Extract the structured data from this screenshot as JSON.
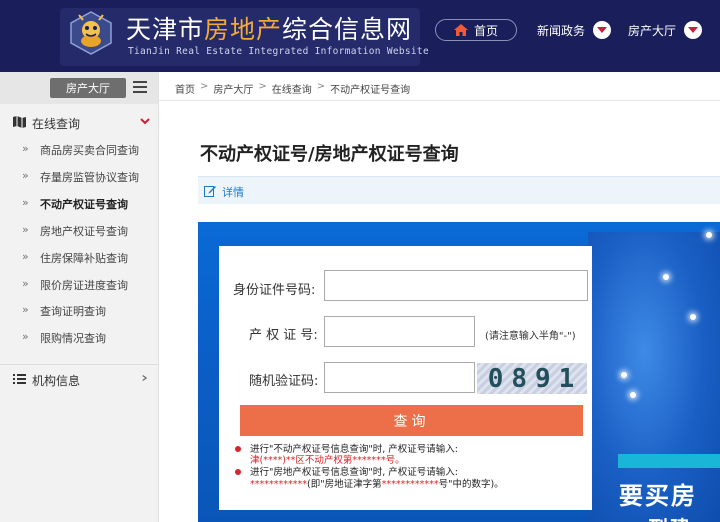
{
  "header": {
    "title_part1": "天津市",
    "title_accent": "房地产",
    "title_part2": "综合信息网",
    "subtitle": "TianJin Real Estate Integrated Information Website",
    "home_label": "首页",
    "nav": [
      {
        "label": "新闻政务"
      },
      {
        "label": "房产大厅"
      }
    ]
  },
  "sidebar": {
    "top_label": "房产大厅",
    "query_section": "在线查询",
    "items": [
      {
        "label": "商品房买卖合同查询"
      },
      {
        "label": "存量房监管协议查询"
      },
      {
        "label": "不动产权证号查询"
      },
      {
        "label": "房地产权证号查询"
      },
      {
        "label": "住房保障补贴查询"
      },
      {
        "label": "限价房证进度查询"
      },
      {
        "label": "查询证明查询"
      },
      {
        "label": "限购情况查询"
      }
    ],
    "active_index": 2,
    "org_section": "机构信息"
  },
  "breadcrumb": [
    "首页",
    "房产大厅",
    "在线查询",
    "不动产权证号查询"
  ],
  "page": {
    "title": "不动产权证号/房地产权证号查询",
    "detail_label": "详情"
  },
  "form": {
    "id_label": "身份证件号码:",
    "id_value": "",
    "cert_label": "产 权 证 号:",
    "cert_value": "",
    "cert_hint": "(请注意输入半角\"-\")",
    "captcha_label": "随机验证码:",
    "captcha_value": "",
    "captcha_digits": [
      "0",
      "8",
      "9",
      "1"
    ],
    "submit_label": "查询"
  },
  "notes": {
    "n1_text": "进行\"不动产权证号信息查询\"时, 产权证号请输入:",
    "n1_red": "津(****)**区不动产权第*******号。",
    "n2_text": "进行\"房地产权证号信息查询\"时, 产权证号请输入:",
    "n2_red1": "************",
    "n2_mid": "(即\"房地证津字第",
    "n2_red2": "************",
    "n2_end": "号\"中的数字)。"
  },
  "banner": {
    "text1": "要买房",
    "text2": "到建"
  },
  "colors": {
    "header_bg": "#1a1f5c",
    "accent_orange": "#f4a93a",
    "button": "#ec6f49",
    "banner_blue": "#0a6ad6",
    "link_blue": "#1e78c8",
    "note_red": "#d8242b"
  }
}
